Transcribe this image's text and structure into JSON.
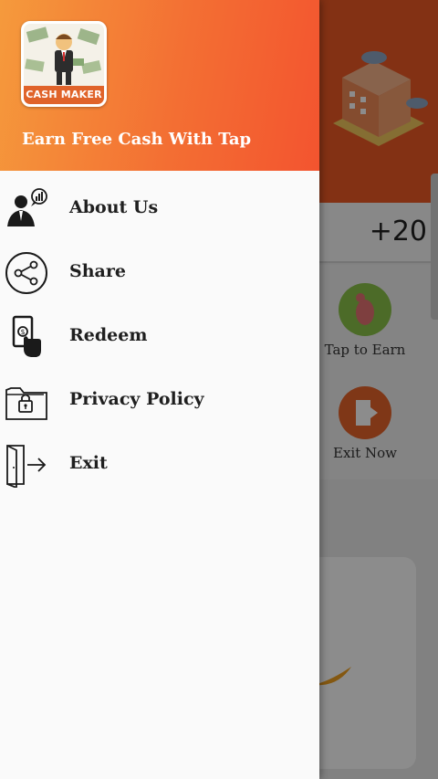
{
  "drawer": {
    "app_logo_text": "CASH MAKER",
    "tagline": "Earn Free Cash With Tap",
    "items": [
      {
        "label": "About Us",
        "icon": "about-us-icon"
      },
      {
        "label": "Share",
        "icon": "share-icon"
      },
      {
        "label": "Redeem",
        "icon": "redeem-icon"
      },
      {
        "label": "Privacy Policy",
        "icon": "privacy-policy-icon"
      },
      {
        "label": "Exit",
        "icon": "exit-icon"
      }
    ]
  },
  "background": {
    "points": "+20",
    "tiles": [
      {
        "label": "Tap to Earn",
        "icon": "tap-icon"
      },
      {
        "label": "Exit Now",
        "icon": "exit-door-icon"
      }
    ]
  },
  "colors": {
    "header_gradient_start": "#f59a3c",
    "header_gradient_end": "#f3542f",
    "accent": "#ee5a26"
  }
}
